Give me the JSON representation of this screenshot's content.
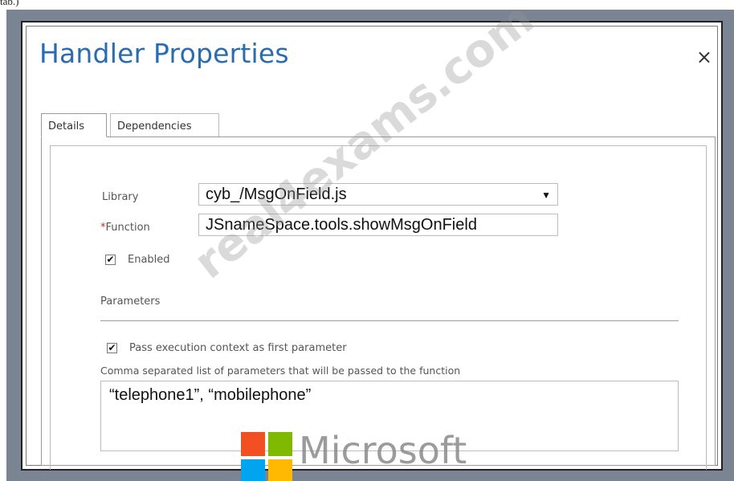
{
  "page_fragment": "tab.)",
  "dialog": {
    "title": "Handler Properties",
    "close_glyph": "×"
  },
  "tabs": [
    {
      "label": "Details",
      "active": true
    },
    {
      "label": "Dependencies",
      "active": false
    }
  ],
  "details": {
    "library_label": "Library",
    "library_value": "cyb_/MsgOnField.js",
    "library_arrow": "▼",
    "function_required_mark": "*",
    "function_label": "Function",
    "function_value": "JSnameSpace.tools.showMsgOnField",
    "enabled_label": "Enabled",
    "enabled_checked": true,
    "parameters_heading": "Parameters",
    "pass_context_label": "Pass execution context as first parameter",
    "pass_context_checked": true,
    "params_hint": "Comma separated list of parameters that will be passed to the function",
    "params_value": "“telephone1”, “mobilephone”",
    "check_glyph": "✔"
  },
  "watermark": {
    "text": "real4exams.com"
  },
  "logo": {
    "text": "Microsoft",
    "colors": [
      "#f25022",
      "#7fba00",
      "#00a4ef",
      "#ffb900"
    ]
  }
}
